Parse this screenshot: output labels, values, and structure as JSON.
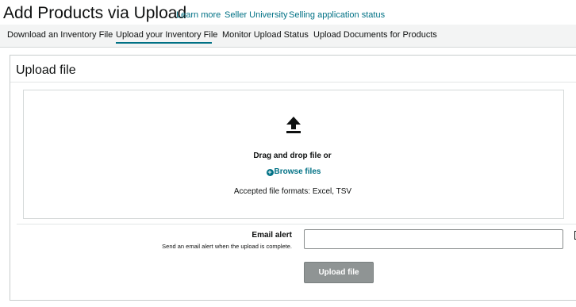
{
  "header": {
    "title": "Add Products via Upload",
    "links": [
      "Learn more",
      "Seller University",
      "Selling application status"
    ]
  },
  "tabs": [
    {
      "label": "Download an Inventory File"
    },
    {
      "label": "Upload your Inventory File",
      "active": true
    },
    {
      "label": "Monitor Upload Status"
    },
    {
      "label": "Upload Documents for Products"
    }
  ],
  "upload_panel": {
    "title": "Upload file",
    "dropzone": {
      "icon": "upload-arrow-icon",
      "drag_text": "Drag and drop file or",
      "browse_label": "Browse files",
      "formats_text": "Accepted file formats: Excel, TSV"
    },
    "email_alert": {
      "label": "Email alert",
      "help_text": "Send an email alert when the upload is complete.",
      "value": "",
      "placeholder": ""
    },
    "submit_label": "Upload file"
  },
  "colors": {
    "link": "#007185",
    "tab_bar": "#f3f4f4",
    "button_disabled": "#8f9494"
  }
}
